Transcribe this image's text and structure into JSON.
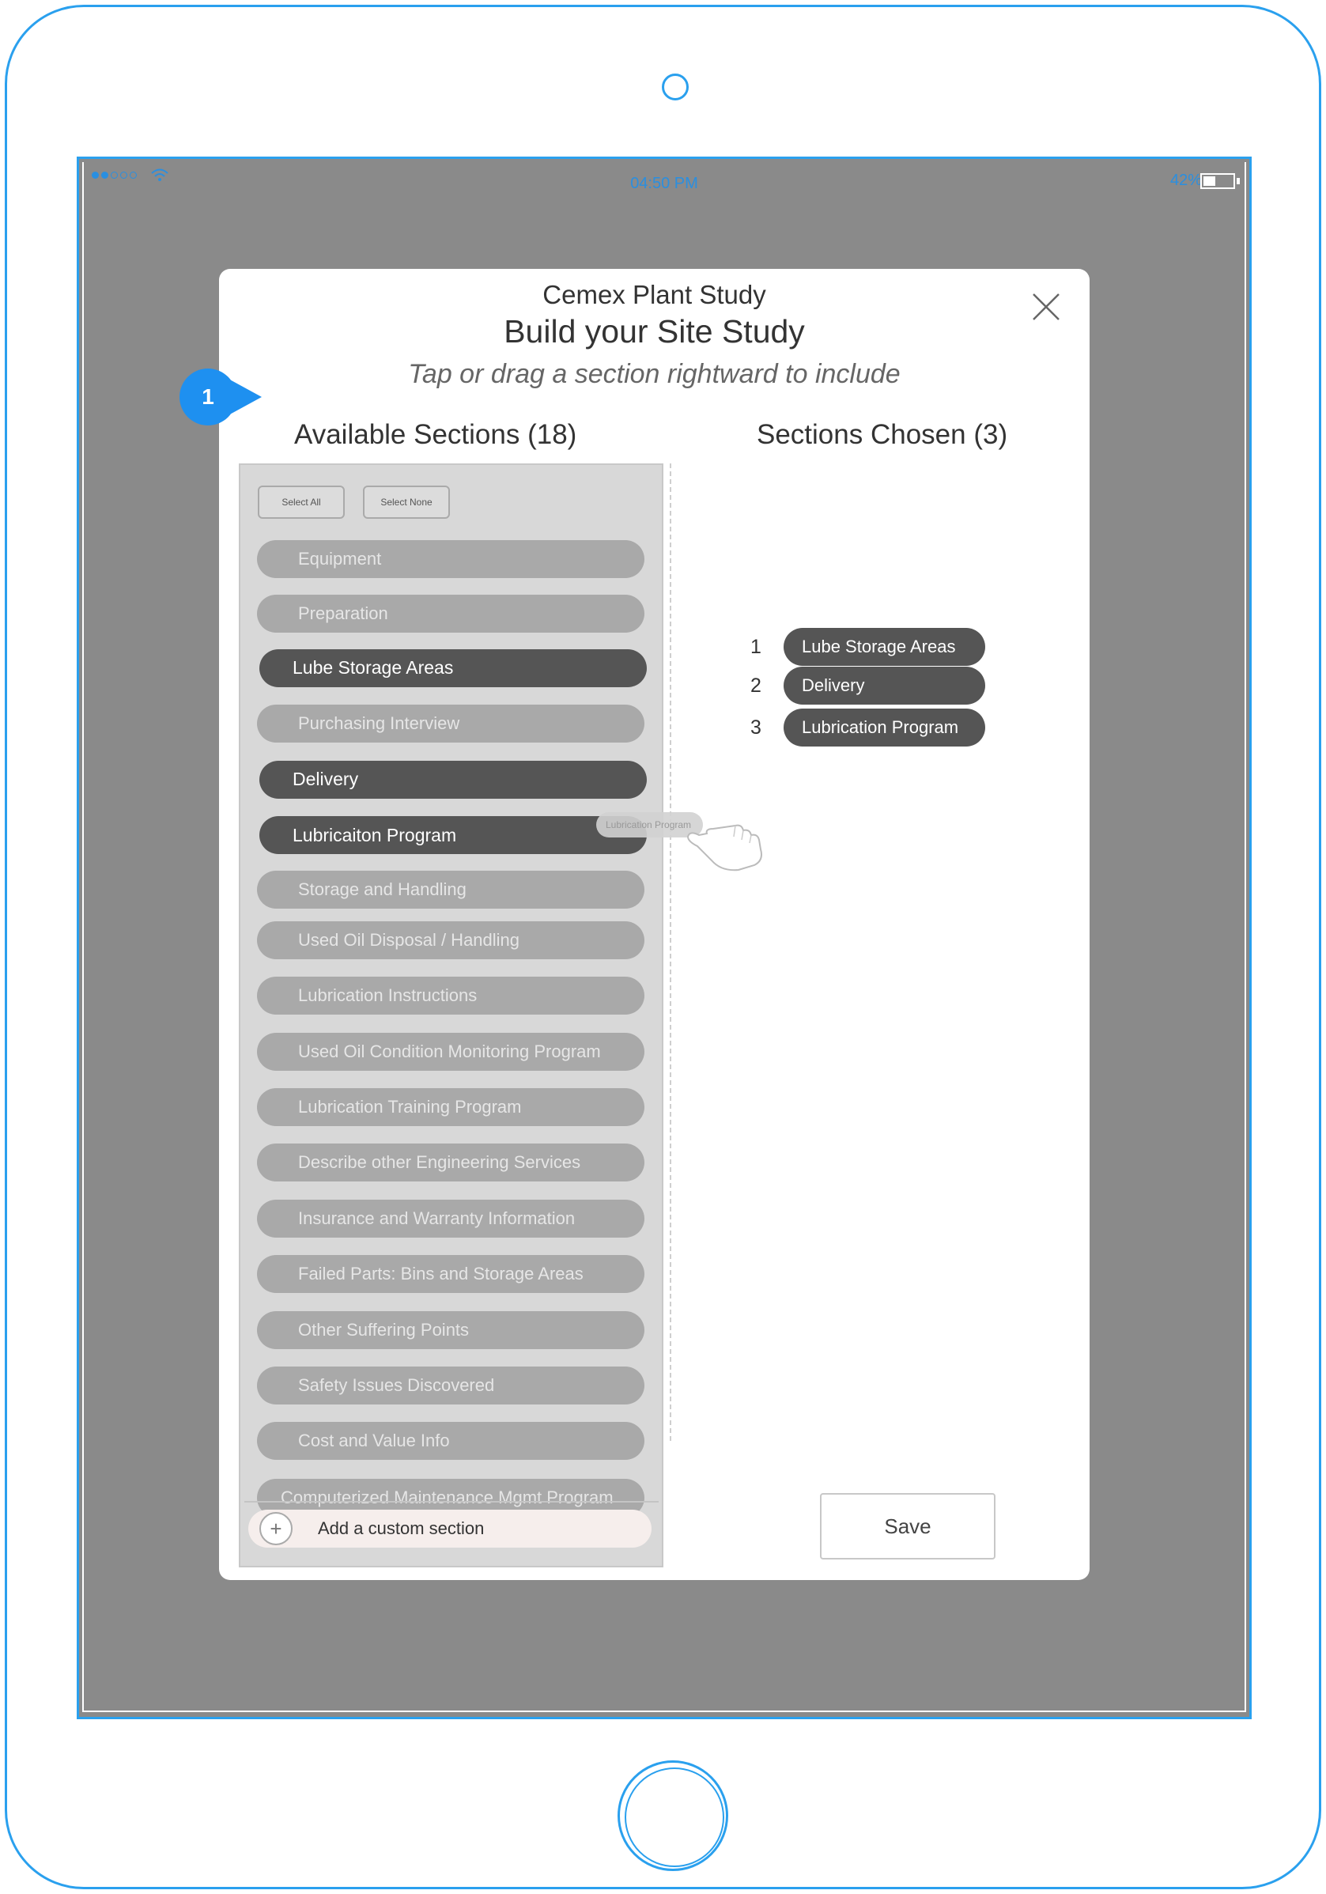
{
  "status_bar": {
    "time": "04:50 PM",
    "battery": "42%",
    "battery_level": 0.42
  },
  "modal": {
    "title": "Cemex Plant Study",
    "heading": "Build your Site Study",
    "subtitle": "Tap or drag a section rightward to include"
  },
  "callout": {
    "number": "1"
  },
  "available": {
    "title": "Available Sections (18)",
    "select_all": "Select All",
    "select_none": "Select None",
    "items": [
      {
        "label": "Equipment",
        "selected": false
      },
      {
        "label": "Preparation",
        "selected": false
      },
      {
        "label": "Lube Storage Areas",
        "selected": true
      },
      {
        "label": "Purchasing Interview",
        "selected": false
      },
      {
        "label": "Delivery",
        "selected": true
      },
      {
        "label": "Lubricaiton Program",
        "selected": true
      },
      {
        "label": "Storage and Handling",
        "selected": false
      },
      {
        "label": "Used Oil Disposal / Handling",
        "selected": false
      },
      {
        "label": "Lubrication Instructions",
        "selected": false
      },
      {
        "label": "Used Oil Condition Monitoring Program",
        "selected": false
      },
      {
        "label": "Lubrication Training Program",
        "selected": false
      },
      {
        "label": "Describe other Engineering Services",
        "selected": false
      },
      {
        "label": "Insurance and Warranty Information",
        "selected": false
      },
      {
        "label": "Failed Parts: Bins and Storage Areas",
        "selected": false
      },
      {
        "label": "Other Suffering Points",
        "selected": false
      },
      {
        "label": "Safety Issues Discovered",
        "selected": false
      },
      {
        "label": "Cost and Value Info",
        "selected": false
      },
      {
        "label": "Computerized Maintenance Mgmt Program",
        "selected": false
      }
    ],
    "drag_ghost": "Lubrication Program",
    "add_custom": "Add a custom section"
  },
  "chosen": {
    "title": "Sections Chosen (3)",
    "items": [
      {
        "number": "1",
        "label": "Lube Storage Areas"
      },
      {
        "number": "2",
        "label": "Delivery"
      },
      {
        "number": "3",
        "label": "Lubrication Program"
      }
    ]
  },
  "save_label": "Save",
  "colors": {
    "device_outline": "#2aa0ee",
    "screen_dim": "#8a8a8a",
    "pill_selected": "#555555",
    "pill_unselected": "#a9a9a9",
    "callout": "#1e90f0"
  }
}
